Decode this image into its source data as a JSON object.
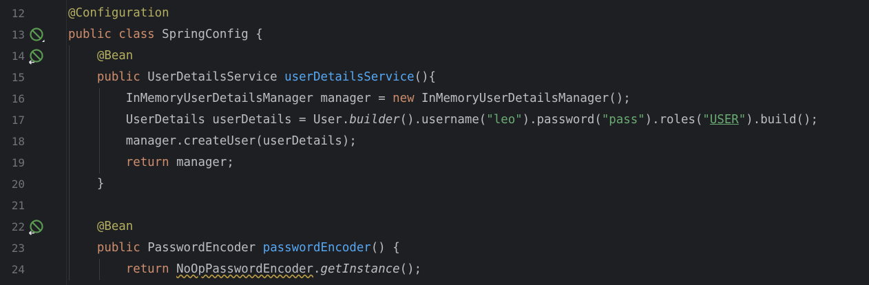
{
  "editor": {
    "colors": {
      "background": "#1e1f22",
      "line_number": "#6f737a",
      "text": "#bcbec4",
      "keyword": "#cf8e6d",
      "annotation": "#b3ae60",
      "method": "#56a8f5",
      "string": "#6aab73",
      "spring_icon": "#5a9a52"
    },
    "lines": [
      {
        "number": "12",
        "gutter_icon": "",
        "tokens": [
          {
            "text": "@Configuration",
            "kind": "annotation"
          }
        ]
      },
      {
        "number": "13",
        "gutter_icon": "spring-bean-icon",
        "tokens": [
          {
            "text": "public class ",
            "kind": "keyword"
          },
          {
            "text": "SpringConfig {",
            "kind": "plain"
          }
        ]
      },
      {
        "number": "14",
        "gutter_icon": "spring-bean-navigate-icon",
        "tokens": [
          {
            "text": "    ",
            "kind": "plain"
          },
          {
            "text": "@Bean",
            "kind": "annotation"
          }
        ]
      },
      {
        "number": "15",
        "gutter_icon": "",
        "tokens": [
          {
            "text": "    ",
            "kind": "plain"
          },
          {
            "text": "public ",
            "kind": "keyword"
          },
          {
            "text": "UserDetailsService ",
            "kind": "plain"
          },
          {
            "text": "userDetailsService",
            "kind": "method"
          },
          {
            "text": "(){",
            "kind": "plain"
          }
        ]
      },
      {
        "number": "16",
        "gutter_icon": "",
        "tokens": [
          {
            "text": "        InMemoryUserDetailsManager manager = ",
            "kind": "plain"
          },
          {
            "text": "new ",
            "kind": "keyword"
          },
          {
            "text": "InMemoryUserDetailsManager();",
            "kind": "plain"
          }
        ]
      },
      {
        "number": "17",
        "gutter_icon": "",
        "tokens": [
          {
            "text": "        UserDetails userDetails = User.",
            "kind": "plain"
          },
          {
            "text": "builder",
            "kind": "italic"
          },
          {
            "text": "().username(",
            "kind": "plain"
          },
          {
            "text": "\"leo\"",
            "kind": "string"
          },
          {
            "text": ").password(",
            "kind": "plain"
          },
          {
            "text": "\"pass\"",
            "kind": "string"
          },
          {
            "text": ").roles(",
            "kind": "plain"
          },
          {
            "text": "\"",
            "kind": "string"
          },
          {
            "text": "USER",
            "kind": "string-underlined"
          },
          {
            "text": "\"",
            "kind": "string"
          },
          {
            "text": ").build();",
            "kind": "plain"
          }
        ]
      },
      {
        "number": "18",
        "gutter_icon": "",
        "tokens": [
          {
            "text": "        manager.createUser(userDetails);",
            "kind": "plain"
          }
        ]
      },
      {
        "number": "19",
        "gutter_icon": "",
        "tokens": [
          {
            "text": "        ",
            "kind": "plain"
          },
          {
            "text": "return ",
            "kind": "keyword"
          },
          {
            "text": "manager;",
            "kind": "plain"
          }
        ]
      },
      {
        "number": "20",
        "gutter_icon": "",
        "tokens": [
          {
            "text": "    }",
            "kind": "plain"
          }
        ]
      },
      {
        "number": "21",
        "gutter_icon": "",
        "tokens": []
      },
      {
        "number": "22",
        "gutter_icon": "spring-bean-navigate-icon",
        "tokens": [
          {
            "text": "    ",
            "kind": "plain"
          },
          {
            "text": "@Bean",
            "kind": "annotation"
          }
        ]
      },
      {
        "number": "23",
        "gutter_icon": "",
        "tokens": [
          {
            "text": "    ",
            "kind": "plain"
          },
          {
            "text": "public ",
            "kind": "keyword"
          },
          {
            "text": "PasswordEncoder ",
            "kind": "plain"
          },
          {
            "text": "passwordEncoder",
            "kind": "method"
          },
          {
            "text": "() {",
            "kind": "plain"
          }
        ]
      },
      {
        "number": "24",
        "gutter_icon": "",
        "tokens": [
          {
            "text": "        ",
            "kind": "plain"
          },
          {
            "text": "return ",
            "kind": "keyword"
          },
          {
            "text": "NoOpPasswordEncoder",
            "kind": "warning"
          },
          {
            "text": ".",
            "kind": "plain"
          },
          {
            "text": "getInstance",
            "kind": "italic"
          },
          {
            "text": "();",
            "kind": "plain"
          }
        ]
      }
    ]
  }
}
